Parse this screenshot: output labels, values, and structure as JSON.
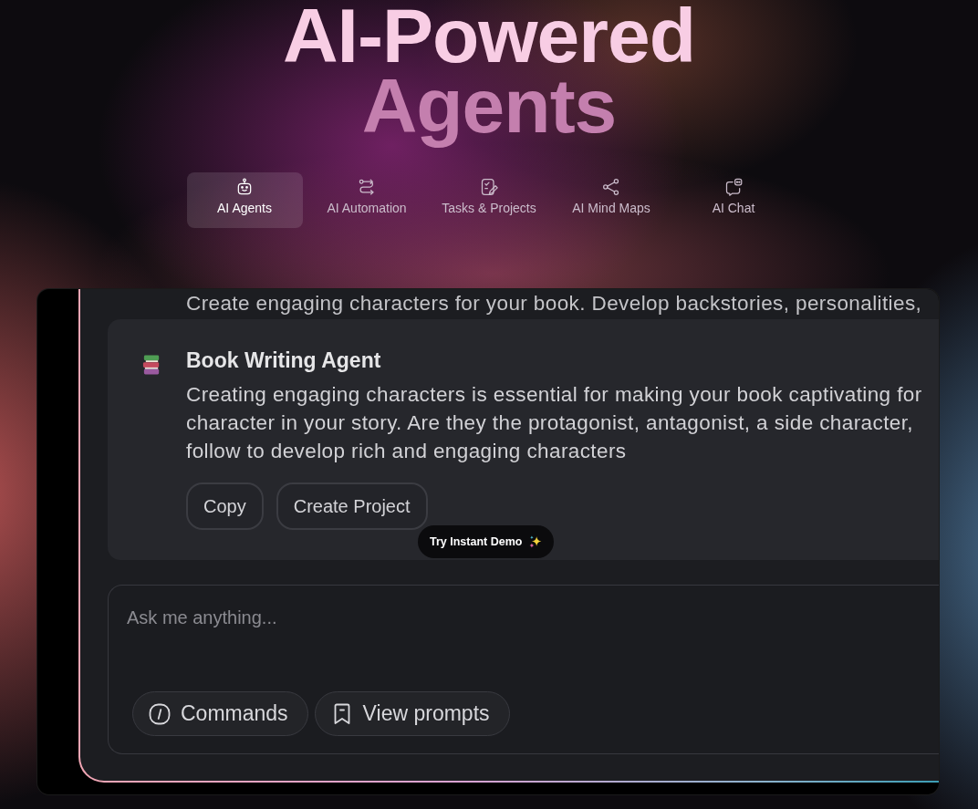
{
  "heading": {
    "line_1": "AI-Powered",
    "line_2": "Agents"
  },
  "tabs": [
    {
      "label": "AI Agents",
      "selected": true
    },
    {
      "label": "AI Automation",
      "selected": false
    },
    {
      "label": "Tasks & Projects",
      "selected": false
    },
    {
      "label": "AI Mind Maps",
      "selected": false
    },
    {
      "label": "AI Chat",
      "selected": false
    }
  ],
  "demo": {
    "previous_message": "Create engaging characters for your book. Develop backstories, personalities,",
    "message": {
      "author": "Book Writing Agent",
      "lines": [
        "Creating engaging characters is essential for making your book captivating for",
        "character in your story. Are they the protagonist, antagonist, a side character,",
        "follow to develop rich and engaging characters"
      ],
      "actions": [
        "Copy",
        "Create Project"
      ]
    },
    "demo_button": "Try Instant Demo",
    "composer": {
      "placeholder": "Ask me anything...",
      "buttons": [
        "Commands",
        "View prompts"
      ]
    }
  }
}
